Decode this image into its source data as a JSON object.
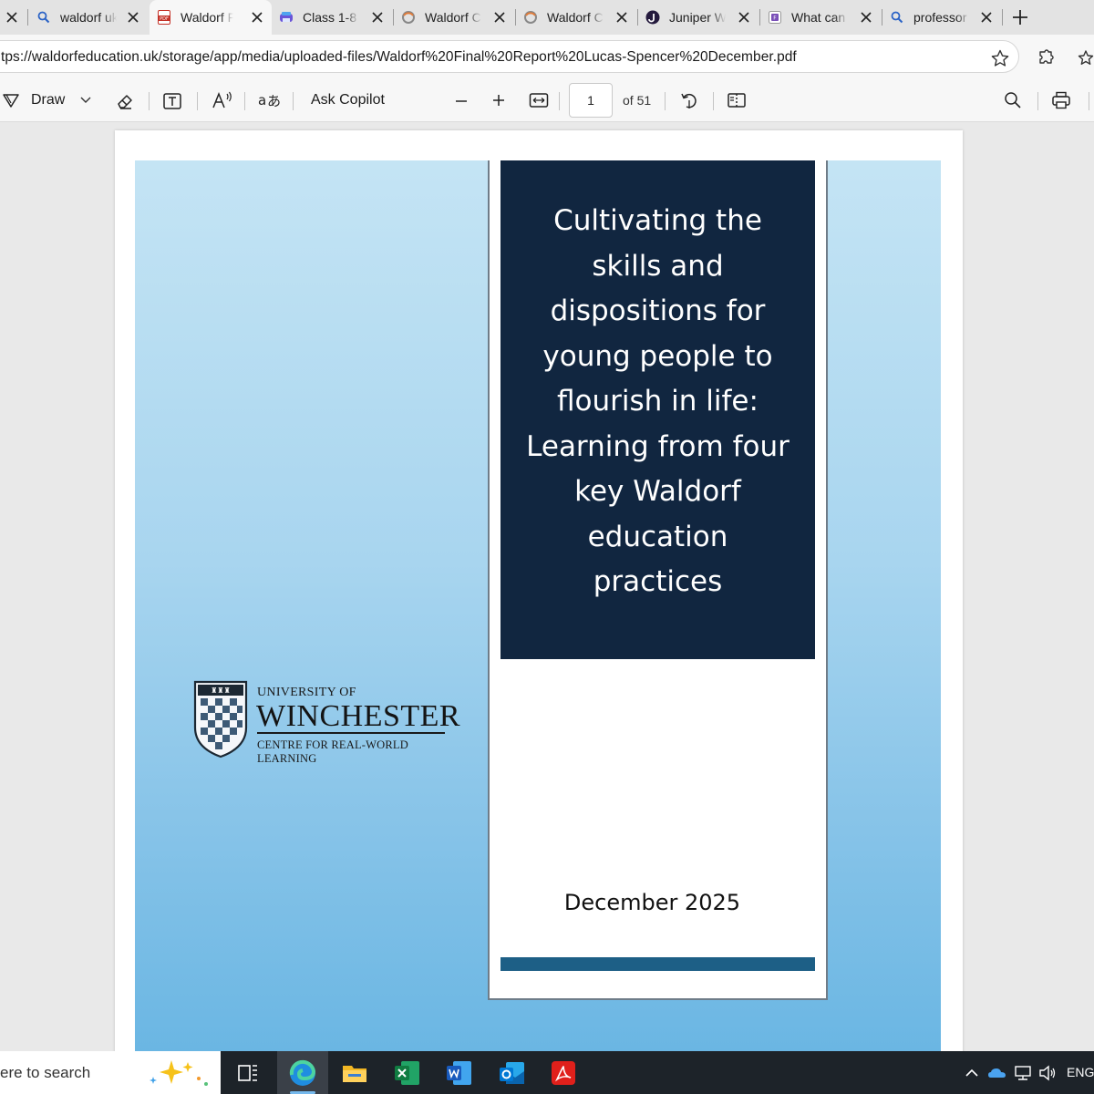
{
  "browser": {
    "tabs": [
      {
        "title": "waldorf uk",
        "icon": "search-icon",
        "active": false
      },
      {
        "title": "Waldorf Final Report",
        "icon": "pdf-icon",
        "active": true
      },
      {
        "title": "Class 1-8",
        "icon": "printer-icon",
        "active": false
      },
      {
        "title": "Waldorf C",
        "icon": "copilot-icon",
        "active": false
      },
      {
        "title": "Waldorf C",
        "icon": "copilot-icon",
        "active": false
      },
      {
        "title": "Juniper W",
        "icon": "juniper-icon",
        "active": false
      },
      {
        "title": "What can",
        "icon": "forms-icon",
        "active": false
      },
      {
        "title": "professor",
        "icon": "search-icon",
        "active": false
      }
    ],
    "url": "tps://waldorfeducation.uk/storage/app/media/uploaded-files/Waldorf%20Final%20Report%20Lucas-Spencer%20December.pdf"
  },
  "pdf_toolbar": {
    "draw_label": "Draw",
    "copilot_label": "Ask Copilot",
    "page_number": "1",
    "page_count": "of 51"
  },
  "document": {
    "title_lines": [
      "Cultivating the",
      "skills and",
      "dispositions for",
      "young people to",
      "flourish in life:",
      "Learning from four",
      "key Waldorf",
      "education",
      "practices"
    ],
    "date": "December 2025",
    "logo": {
      "line1": "UNIVERSITY OF",
      "line2": "WINCHESTER",
      "line3": "CENTRE FOR REAL-WORLD LEARNING"
    },
    "colors": {
      "title_box": "#112640",
      "accent_bar": "#1d5f86",
      "cover_gradient_top": "#c4e4f4",
      "cover_gradient_bottom": "#6ab6e3"
    }
  },
  "taskbar": {
    "search_text": "ere to search",
    "language": "ENG",
    "apps": [
      "task-view-icon",
      "edge-icon",
      "file-explorer-icon",
      "excel-icon",
      "word-icon",
      "outlook-icon",
      "acrobat-icon"
    ]
  }
}
